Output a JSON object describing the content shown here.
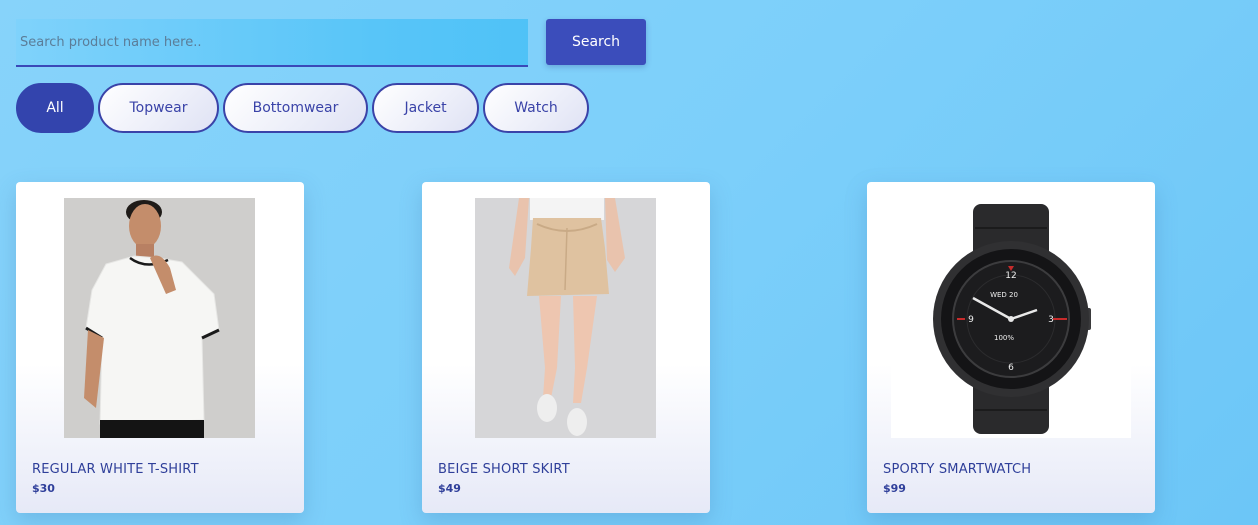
{
  "search": {
    "placeholder": "Search product name here..",
    "button_label": "Search"
  },
  "filters": [
    {
      "label": "All",
      "active": true
    },
    {
      "label": "Topwear",
      "active": false
    },
    {
      "label": "Bottomwear",
      "active": false
    },
    {
      "label": "Jacket",
      "active": false
    },
    {
      "label": "Watch",
      "active": false
    }
  ],
  "products": [
    {
      "name": "REGULAR WHITE T-SHIRT",
      "price": "$30",
      "image": "white-tshirt-model-photo"
    },
    {
      "name": "BEIGE SHORT SKIRT",
      "price": "$49",
      "image": "beige-skirt-model-photo"
    },
    {
      "name": "SPORTY SMARTWATCH",
      "price": "$99",
      "image": "smartwatch-photo"
    }
  ],
  "watch_face": {
    "date": "WED 20",
    "battery": "100%",
    "numerals": [
      "12",
      "3",
      "6",
      "9"
    ]
  },
  "colors": {
    "accent": "#3b4dbb",
    "text": "#2f3f9a",
    "background": "#7ccffa"
  }
}
